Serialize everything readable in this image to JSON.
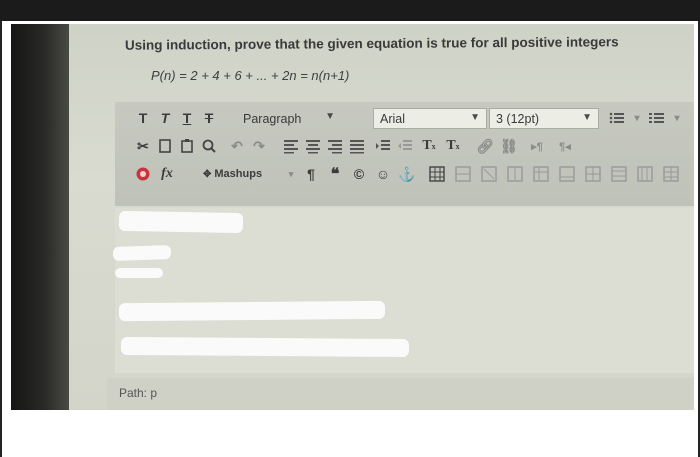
{
  "question": {
    "text": "Using induction, prove that the given equation is true for all positive integers",
    "equation": "P(n) = 2 + 4 + 6 + ... + 2n = n(n+1)"
  },
  "toolbar": {
    "format_buttons": [
      "T",
      "T",
      "T",
      "T"
    ],
    "paragraph_select": "Paragraph",
    "font_select": "Arial",
    "size_select": "3 (12pt)",
    "mashups_label": "Mashups",
    "superscript": "T",
    "subscript": "T",
    "formula_label": "fx"
  },
  "status": {
    "path_label": "Path: p"
  },
  "colors": {
    "photo_bg": "#d3d5ca",
    "toolbar_bg": "#c3c6bd",
    "redaction": "#fafafa"
  }
}
